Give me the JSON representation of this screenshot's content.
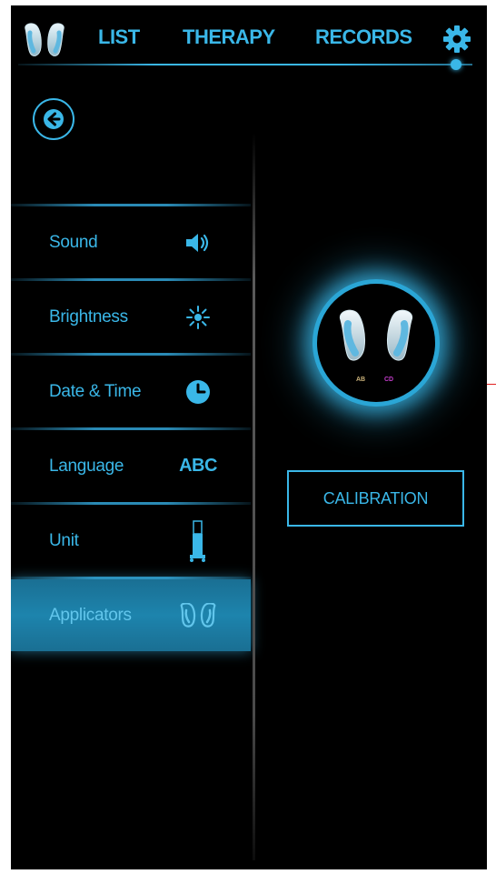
{
  "nav": {
    "items": [
      {
        "label": "LIST"
      },
      {
        "label": "THERAPY"
      },
      {
        "label": "RECORDS"
      }
    ],
    "logo_icon": "applicator-pair-icon",
    "settings_icon": "gear-icon"
  },
  "back": {
    "icon": "arrow-left-icon"
  },
  "sidebar": {
    "items": [
      {
        "label": "Sound",
        "icon": "speaker-icon"
      },
      {
        "label": "Brightness",
        "icon": "sun-icon"
      },
      {
        "label": "Date & Time",
        "icon": "clock-icon"
      },
      {
        "label": "Language",
        "icon_text": "ABC"
      },
      {
        "label": "Unit",
        "icon": "device-unit-icon"
      },
      {
        "label": "Applicators",
        "icon": "applicators-icon",
        "active": true
      }
    ]
  },
  "panel": {
    "channel_ab": "AB",
    "channel_cd": "CD",
    "calibration_label": "CALIBRATION"
  },
  "colors": {
    "accent": "#3ab7e8",
    "active_bg": "#1d84ad",
    "background": "#000000",
    "channel_ab": "#cbb27a",
    "channel_cd": "#c23cc9"
  }
}
